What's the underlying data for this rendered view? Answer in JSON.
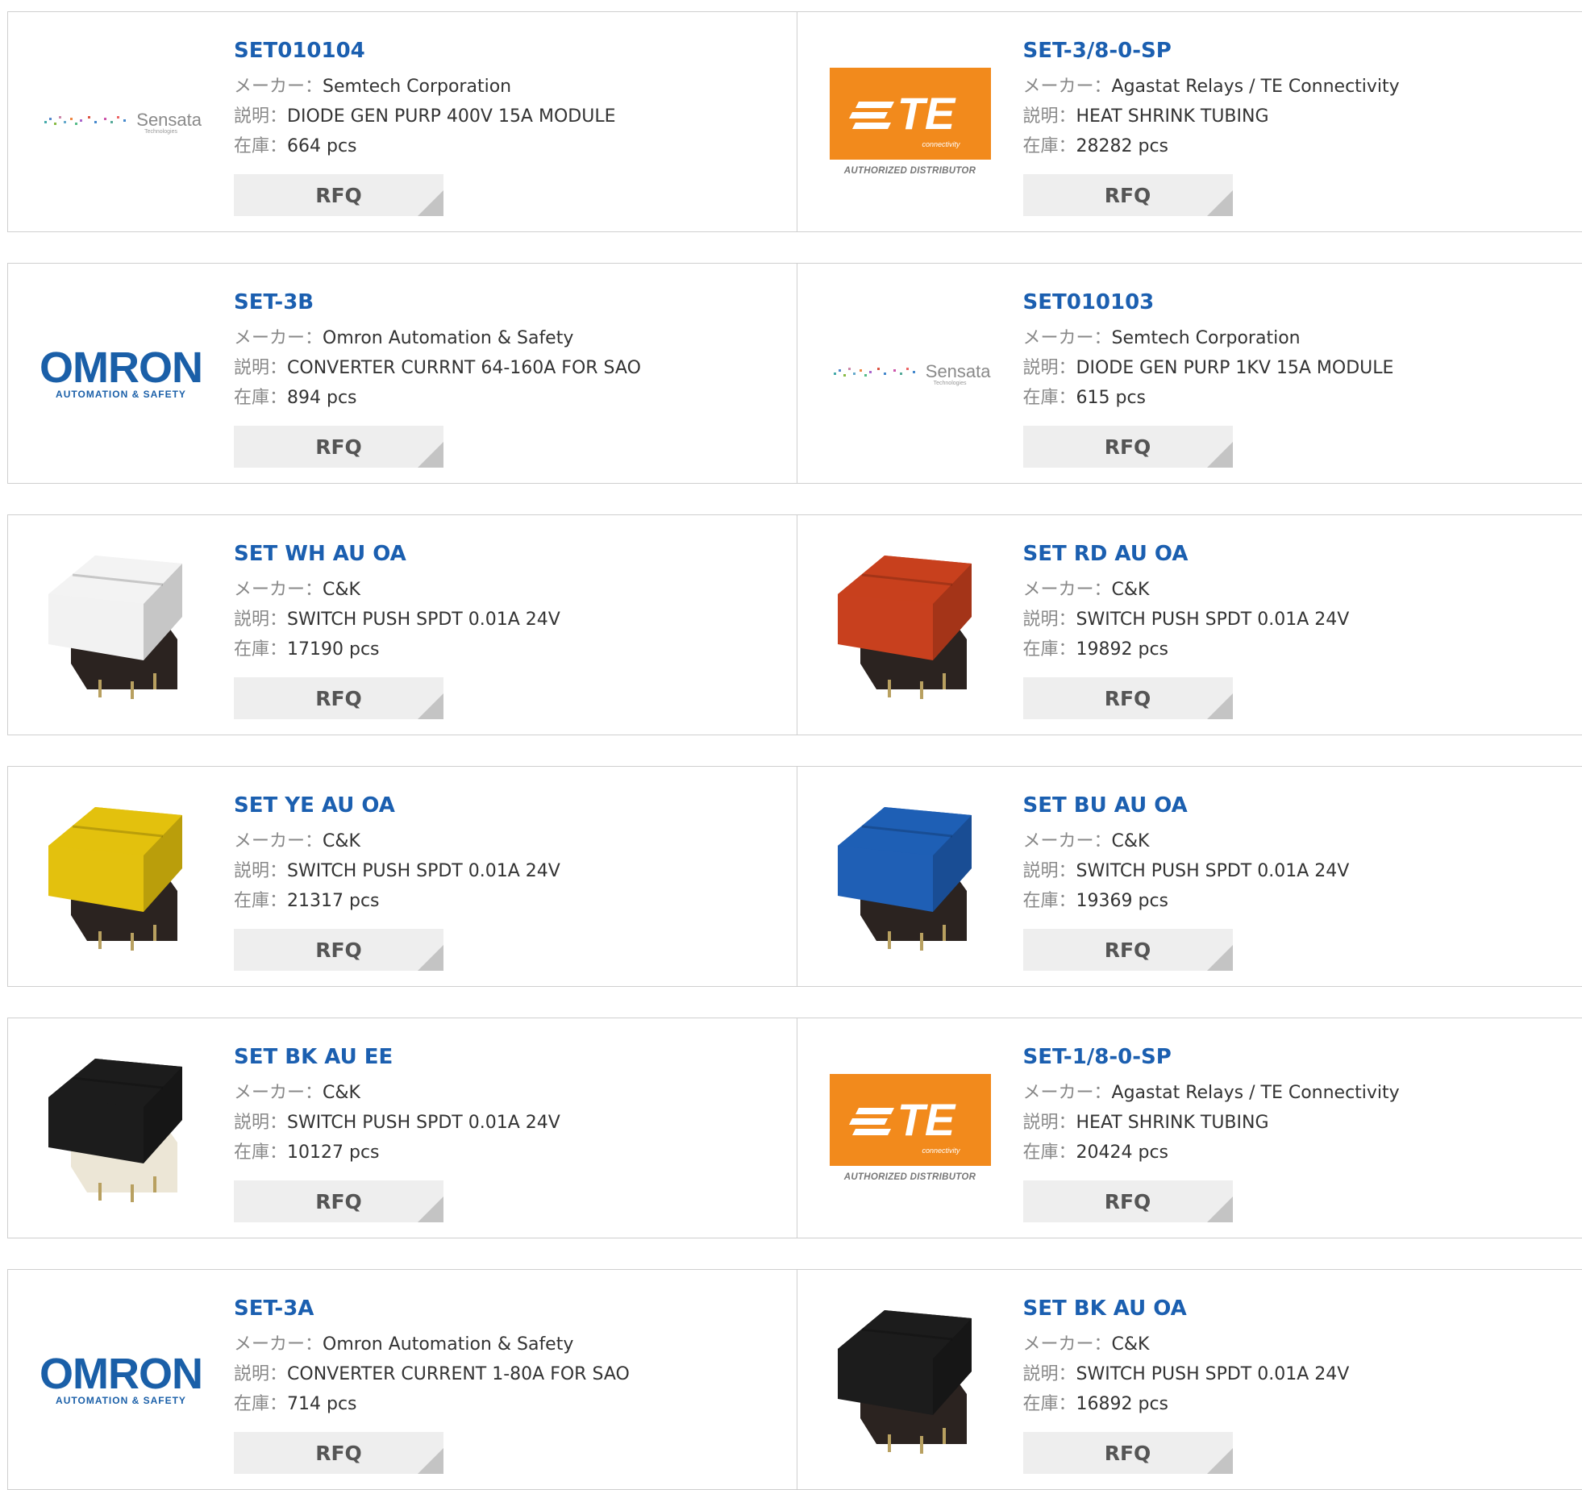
{
  "labels": {
    "manufacturer": "メーカー：",
    "description": "説明：",
    "stock": "在庫：",
    "rfq": "RFQ"
  },
  "products": [
    {
      "part": "SET010104",
      "manufacturer": "Semtech Corporation",
      "description": "DIODE GEN PURP 400V 15A MODULE",
      "stock": "664 pcs",
      "image": "sensata-logo",
      "logo_text": "Sensata",
      "logo_sub": "Technologies"
    },
    {
      "part": "SET-3/8-0-SP",
      "manufacturer": "Agastat Relays / TE Connectivity",
      "description": "HEAT SHRINK TUBING",
      "stock": "28282 pcs",
      "image": "te-logo",
      "logo_text": "TE",
      "logo_sub": "connectivity",
      "logo_caption": "AUTHORIZED DISTRIBUTOR"
    },
    {
      "part": "SET-3B",
      "manufacturer": "Omron Automation & Safety",
      "description": "CONVERTER CURRNT 64-160A FOR SAO",
      "stock": "894 pcs",
      "image": "omron-logo",
      "logo_text": "OMRON",
      "logo_sub": "AUTOMATION & SAFETY"
    },
    {
      "part": "SET010103",
      "manufacturer": "Semtech Corporation",
      "description": "DIODE GEN PURP 1KV 15A MODULE",
      "stock": "615 pcs",
      "image": "sensata-logo",
      "logo_text": "Sensata",
      "logo_sub": "Technologies"
    },
    {
      "part": "SET WH AU OA",
      "manufacturer": "C&K",
      "description": "SWITCH PUSH SPDT 0.01A 24V",
      "stock": "17190 pcs",
      "image": "switch-photo",
      "cap_color": "#f2f2f2",
      "base_color": "#2b2320"
    },
    {
      "part": "SET RD AU OA",
      "manufacturer": "C&K",
      "description": "SWITCH PUSH SPDT 0.01A 24V",
      "stock": "19892 pcs",
      "image": "switch-photo",
      "cap_color": "#c8401e",
      "base_color": "#2b2320"
    },
    {
      "part": "SET YE AU OA",
      "manufacturer": "C&K",
      "description": "SWITCH PUSH SPDT 0.01A 24V",
      "stock": "21317 pcs",
      "image": "switch-photo",
      "cap_color": "#e3c10e",
      "base_color": "#2b2320"
    },
    {
      "part": "SET BU AU OA",
      "manufacturer": "C&K",
      "description": "SWITCH PUSH SPDT 0.01A 24V",
      "stock": "19369 pcs",
      "image": "switch-photo",
      "cap_color": "#1f5fb5",
      "base_color": "#2b2320"
    },
    {
      "part": "SET BK AU EE",
      "manufacturer": "C&K",
      "description": "SWITCH PUSH SPDT 0.01A 24V",
      "stock": "10127 pcs",
      "image": "switch-photo",
      "cap_color": "#1c1c1c",
      "base_color": "#ece6d6"
    },
    {
      "part": "SET-1/8-0-SP",
      "manufacturer": "Agastat Relays / TE Connectivity",
      "description": "HEAT SHRINK TUBING",
      "stock": "20424 pcs",
      "image": "te-logo",
      "logo_text": "TE",
      "logo_sub": "connectivity",
      "logo_caption": "AUTHORIZED DISTRIBUTOR"
    },
    {
      "part": "SET-3A",
      "manufacturer": "Omron Automation & Safety",
      "description": "CONVERTER CURRENT 1-80A FOR SAO",
      "stock": "714 pcs",
      "image": "omron-logo",
      "logo_text": "OMRON",
      "logo_sub": "AUTOMATION & SAFETY"
    },
    {
      "part": "SET BK AU OA",
      "manufacturer": "C&K",
      "description": "SWITCH PUSH SPDT 0.01A 24V",
      "stock": "16892 pcs",
      "image": "switch-photo",
      "cap_color": "#1c1c1c",
      "base_color": "#2b2320"
    }
  ],
  "colors": {
    "part_link": "#1b5fb0",
    "label": "#888888",
    "rfq_bg": "#eeeeee",
    "border": "#cfcfcf"
  }
}
